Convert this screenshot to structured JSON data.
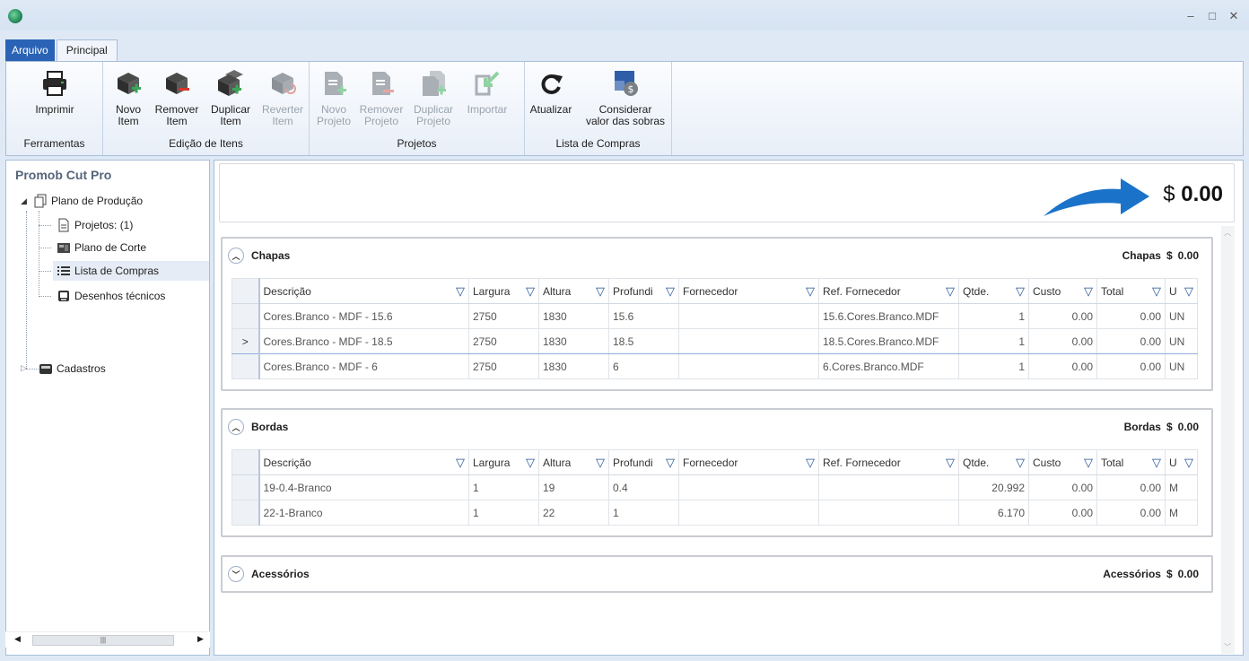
{
  "ribbon_tabs": [
    {
      "label": "Arquivo"
    },
    {
      "label": "Principal"
    }
  ],
  "ribbon": {
    "ferramentas": {
      "label": "Ferramentas",
      "imprimir": "Imprimir"
    },
    "edicao": {
      "label": "Edição de Itens",
      "novo_item": [
        "Novo",
        "Item"
      ],
      "remover_item": [
        "Remover",
        "Item"
      ],
      "duplicar_item": [
        "Duplicar",
        "Item"
      ],
      "reverter_item": [
        "Reverter",
        "Item"
      ]
    },
    "projetos": {
      "label": "Projetos",
      "novo_projeto": [
        "Novo",
        "Projeto"
      ],
      "remover_projeto": [
        "Remover",
        "Projeto"
      ],
      "duplicar_projeto": [
        "Duplicar",
        "Projeto"
      ],
      "importar": "Importar"
    },
    "lista": {
      "label": "Lista de Compras",
      "atualizar": "Atualizar",
      "considerar": [
        "Considerar",
        "valor das sobras"
      ]
    }
  },
  "tree": {
    "title": "Promob Cut Pro",
    "plano_producao": "Plano de Produção",
    "projetos": "Projetos: (1)",
    "plano_corte": "Plano de Corte",
    "lista_compras": "Lista de Compras",
    "desenhos": "Desenhos técnicos",
    "cadastros": "Cadastros"
  },
  "total": {
    "currency": "$",
    "value": "0.00"
  },
  "columns": [
    "Descrição",
    "Largura",
    "Altura",
    "Profundi",
    "Fornecedor",
    "Ref. Fornecedor",
    "Qtde.",
    "Custo",
    "Total",
    "U"
  ],
  "chapas": {
    "title": "Chapas",
    "total_label": "Chapas",
    "currency": "$",
    "total": "0.00",
    "rows": [
      {
        "marker": "",
        "descricao": "Cores.Branco - MDF - 15.6",
        "largura": "2750",
        "altura": "1830",
        "profundidade": "15.6",
        "fornecedor": "",
        "ref": "15.6.Cores.Branco.MDF",
        "qtde": "1",
        "custo": "0.00",
        "total": "0.00",
        "u": "UN"
      },
      {
        "marker": ">",
        "descricao": "Cores.Branco - MDF - 18.5",
        "largura": "2750",
        "altura": "1830",
        "profundidade": "18.5",
        "fornecedor": "",
        "ref": "18.5.Cores.Branco.MDF",
        "qtde": "1",
        "custo": "0.00",
        "total": "0.00",
        "u": "UN"
      },
      {
        "marker": "",
        "descricao": "Cores.Branco - MDF - 6",
        "largura": "2750",
        "altura": "1830",
        "profundidade": "6",
        "fornecedor": "",
        "ref": "6.Cores.Branco.MDF",
        "qtde": "1",
        "custo": "0.00",
        "total": "0.00",
        "u": "UN"
      }
    ]
  },
  "bordas": {
    "title": "Bordas",
    "total_label": "Bordas",
    "currency": "$",
    "total": "0.00",
    "rows": [
      {
        "marker": "",
        "descricao": "19-0.4-Branco",
        "largura": "1",
        "altura": "19",
        "profundidade": "0.4",
        "fornecedor": "",
        "ref": "",
        "qtde": "20.992",
        "custo": "0.00",
        "total": "0.00",
        "u": "M"
      },
      {
        "marker": "",
        "descricao": "22-1-Branco",
        "largura": "1",
        "altura": "22",
        "profundidade": "1",
        "fornecedor": "",
        "ref": "",
        "qtde": "6.170",
        "custo": "0.00",
        "total": "0.00",
        "u": "M"
      }
    ]
  },
  "acessorios": {
    "title": "Acessórios",
    "total_label": "Acessórios",
    "currency": "$",
    "total": "0.00"
  },
  "colors": {
    "accent": "#2a63b5",
    "filter_icon": "#1f4f96",
    "arrow": "#1a73c9"
  }
}
